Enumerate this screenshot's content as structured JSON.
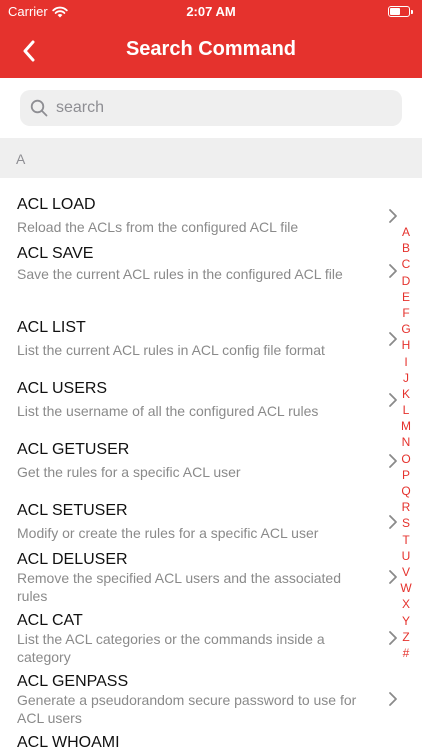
{
  "status_bar": {
    "carrier": "Carrier",
    "time": "2:07 AM"
  },
  "nav": {
    "title": "Search Command",
    "back_icon": "chevron-left-icon"
  },
  "search": {
    "placeholder": "search",
    "value": "",
    "icon": "search-icon"
  },
  "section": {
    "header": "A"
  },
  "commands": [
    {
      "title": "ACL LOAD",
      "description": "Reload the ACLs from the configured ACL file"
    },
    {
      "title": "ACL SAVE",
      "description": "Save the current ACL rules in the configured ACL file"
    },
    {
      "title": "ACL LIST",
      "description": "List the current ACL rules in ACL config file format"
    },
    {
      "title": "ACL USERS",
      "description": "List the username of all the configured ACL rules"
    },
    {
      "title": "ACL GETUSER",
      "description": "Get the rules for a specific ACL user"
    },
    {
      "title": "ACL SETUSER",
      "description": "Modify or create the rules for a specific ACL user"
    },
    {
      "title": "ACL DELUSER",
      "description": "Remove the specified ACL users and the associated rules"
    },
    {
      "title": "ACL CAT",
      "description": "List the ACL categories or the commands inside a category"
    },
    {
      "title": "ACL GENPASS",
      "description": "Generate a pseudorandom secure password to use for ACL users"
    },
    {
      "title": "ACL WHOAMI",
      "description": ""
    }
  ],
  "index_letters": [
    "A",
    "B",
    "C",
    "D",
    "E",
    "F",
    "G",
    "H",
    "I",
    "J",
    "K",
    "L",
    "M",
    "N",
    "O",
    "P",
    "Q",
    "R",
    "S",
    "T",
    "U",
    "V",
    "W",
    "X",
    "Y",
    "Z",
    "#"
  ],
  "colors": {
    "accent": "#e5322d",
    "section_bg": "#efefef",
    "secondary_text": "#8a8a8a"
  }
}
